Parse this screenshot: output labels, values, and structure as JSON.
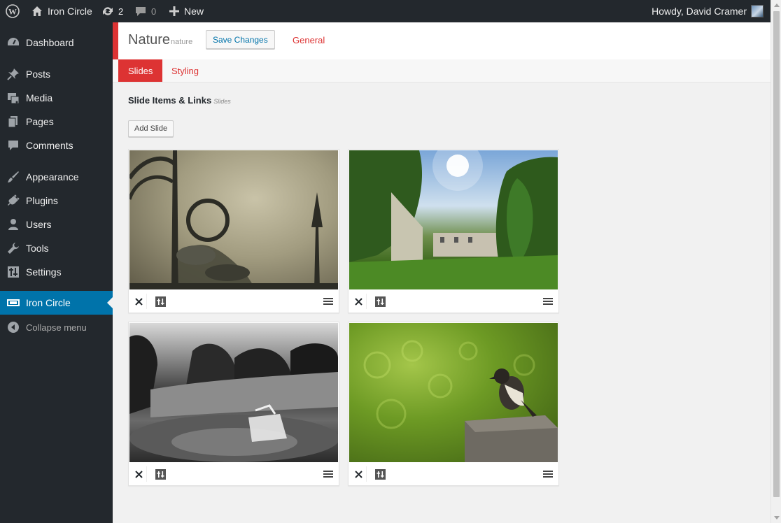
{
  "adminbar": {
    "site_name": "Iron Circle",
    "updates_count": "2",
    "comments_count": "0",
    "new_label": "New",
    "howdy": "Howdy, David Cramer"
  },
  "sidebar": {
    "items": [
      {
        "label": "Dashboard",
        "icon": "dashboard-icon"
      },
      {
        "label": "Posts",
        "icon": "pin-icon"
      },
      {
        "label": "Media",
        "icon": "media-icon"
      },
      {
        "label": "Pages",
        "icon": "pages-icon"
      },
      {
        "label": "Comments",
        "icon": "comment-icon"
      },
      {
        "label": "Appearance",
        "icon": "brush-icon"
      },
      {
        "label": "Plugins",
        "icon": "plugin-icon"
      },
      {
        "label": "Users",
        "icon": "user-icon"
      },
      {
        "label": "Tools",
        "icon": "wrench-icon"
      },
      {
        "label": "Settings",
        "icon": "settings-icon"
      },
      {
        "label": "Iron Circle",
        "icon": "slider-icon"
      },
      {
        "label": "Collapse menu",
        "icon": "collapse-icon"
      }
    ],
    "current_color": "#0073aa"
  },
  "header": {
    "title": "Nature",
    "slug": "nature",
    "save_label": "Save Changes",
    "general_label": "General",
    "accent": "#dd3333"
  },
  "tabs": [
    {
      "label": "Slides",
      "active": true
    },
    {
      "label": "Styling",
      "active": false
    }
  ],
  "section": {
    "title": "Slide Items & Links",
    "subtitle": "Slides",
    "add_label": "Add Slide"
  }
}
